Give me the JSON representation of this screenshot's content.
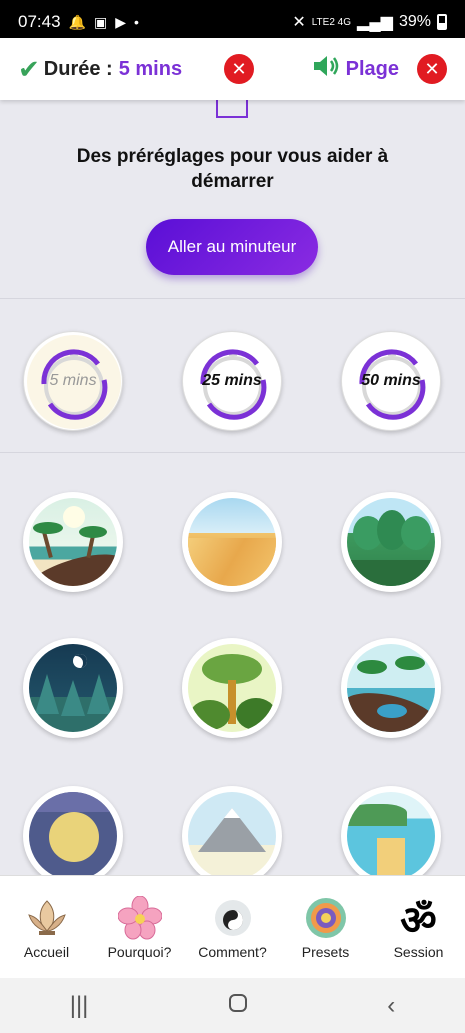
{
  "status": {
    "time": "07:43",
    "notif_icons": [
      "bell",
      "image",
      "youtube",
      "dot"
    ],
    "network": "LTE2 4G",
    "battery": "39%"
  },
  "top": {
    "duration_label": "Durée :",
    "duration_value": "5 mins",
    "sound_label": "Plage"
  },
  "main": {
    "headline": "Des préréglages pour vous aider à démarrer",
    "cta_label": "Aller au minuteur",
    "timers": [
      {
        "label": "5 mins"
      },
      {
        "label": "25 mins"
      },
      {
        "label": "50 mins"
      }
    ],
    "scenes": [
      "beach",
      "desert",
      "forest",
      "night-forest",
      "jungle",
      "tropical-island",
      "cave",
      "mountain",
      "lake"
    ]
  },
  "nav": {
    "items": [
      {
        "label": "Accueil",
        "icon": "lotus-icon"
      },
      {
        "label": "Pourquoi?",
        "icon": "flower-icon"
      },
      {
        "label": "Comment?",
        "icon": "yin-yang-icon"
      },
      {
        "label": "Presets",
        "icon": "mandala-icon"
      },
      {
        "label": "Session",
        "icon": "om-icon"
      }
    ]
  },
  "colors": {
    "accent": "#7b31d6",
    "close": "#e11b22",
    "check": "#38a35a"
  }
}
